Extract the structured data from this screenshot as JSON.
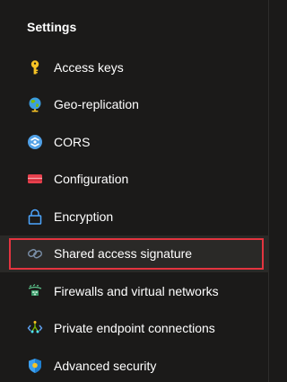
{
  "section_title": "Settings",
  "items": [
    {
      "label": "Access keys",
      "icon": "key-icon"
    },
    {
      "label": "Geo-replication",
      "icon": "globe-icon"
    },
    {
      "label": "CORS",
      "icon": "cors-icon"
    },
    {
      "label": "Configuration",
      "icon": "configuration-icon"
    },
    {
      "label": "Encryption",
      "icon": "lock-icon"
    },
    {
      "label": "Shared access signature",
      "icon": "link-icon",
      "selected": true
    },
    {
      "label": "Firewalls and virtual networks",
      "icon": "firewall-icon"
    },
    {
      "label": "Private endpoint connections",
      "icon": "endpoint-icon"
    },
    {
      "label": "Advanced security",
      "icon": "shield-icon"
    }
  ],
  "colors": {
    "background": "#1b1a19",
    "selected_background": "#2a2927",
    "highlight_border": "#e3343f",
    "key_icon": "#f7c325",
    "globe_icon": "#7fba00",
    "cors_icon": "#50a0e6",
    "config_icon": "#e8404d",
    "lock_icon": "#4da6ff",
    "shield_icon": "#3ca0f0"
  }
}
